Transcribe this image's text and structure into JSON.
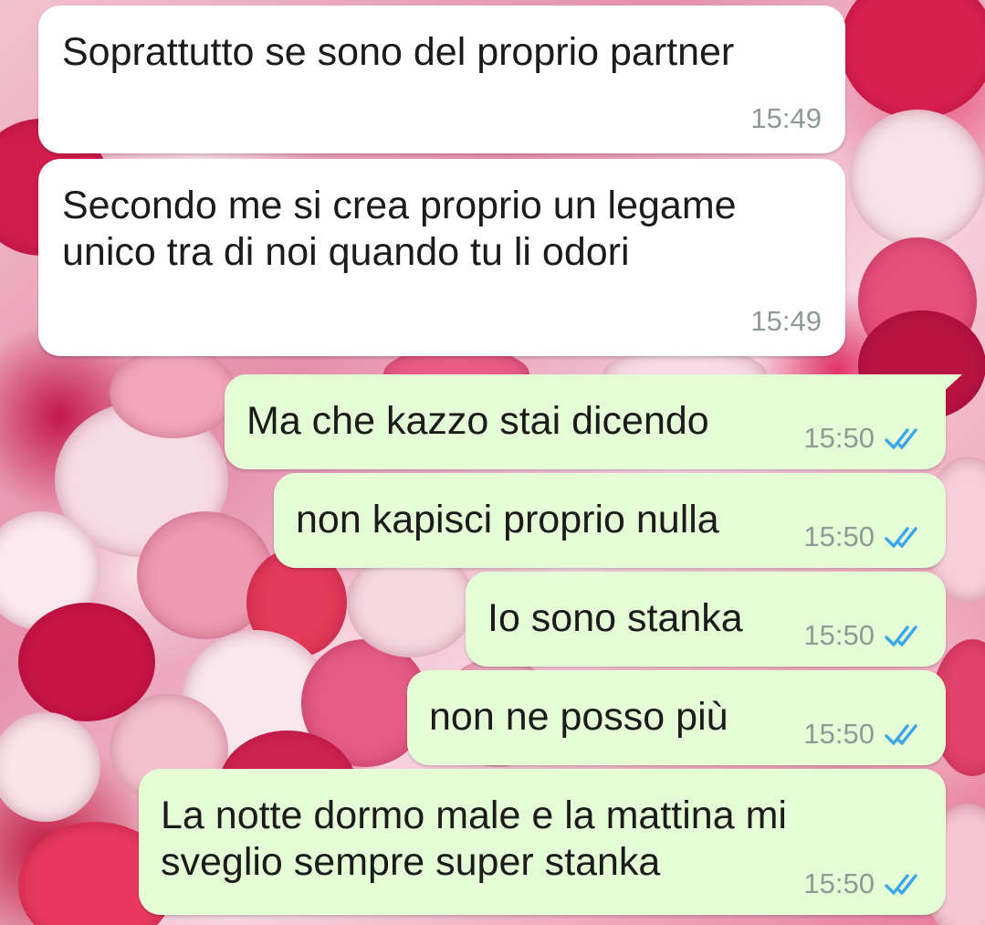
{
  "messages": [
    {
      "direction": "incoming",
      "text": "Soprattutto se sono del proprio partner",
      "time": "15:49"
    },
    {
      "direction": "incoming",
      "text": "Secondo me si crea proprio un legame unico tra di noi quando tu li odori",
      "time": "15:49"
    },
    {
      "direction": "outgoing",
      "text": "Ma che kazzo stai dicendo",
      "time": "15:50",
      "status": "read",
      "status_icon": "double-check-icon"
    },
    {
      "direction": "outgoing",
      "text": "non kapisci proprio nulla",
      "time": "15:50",
      "status": "read",
      "status_icon": "double-check-icon"
    },
    {
      "direction": "outgoing",
      "text": "Io sono stanka",
      "time": "15:50",
      "status": "read",
      "status_icon": "double-check-icon"
    },
    {
      "direction": "outgoing",
      "text": "non ne posso più",
      "time": "15:50",
      "status": "read",
      "status_icon": "double-check-icon"
    },
    {
      "direction": "outgoing",
      "text": "La notte dormo male e la mattina mi sveglio sempre super stanka",
      "time": "15:50",
      "status": "read",
      "status_icon": "double-check-icon"
    }
  ],
  "colors": {
    "incoming_bubble": "#ffffff",
    "outgoing_bubble": "#e4fdd6",
    "timestamp": "#8e9a93",
    "read_ticks": "#3aa6e8"
  },
  "background": "floral-wallpaper"
}
